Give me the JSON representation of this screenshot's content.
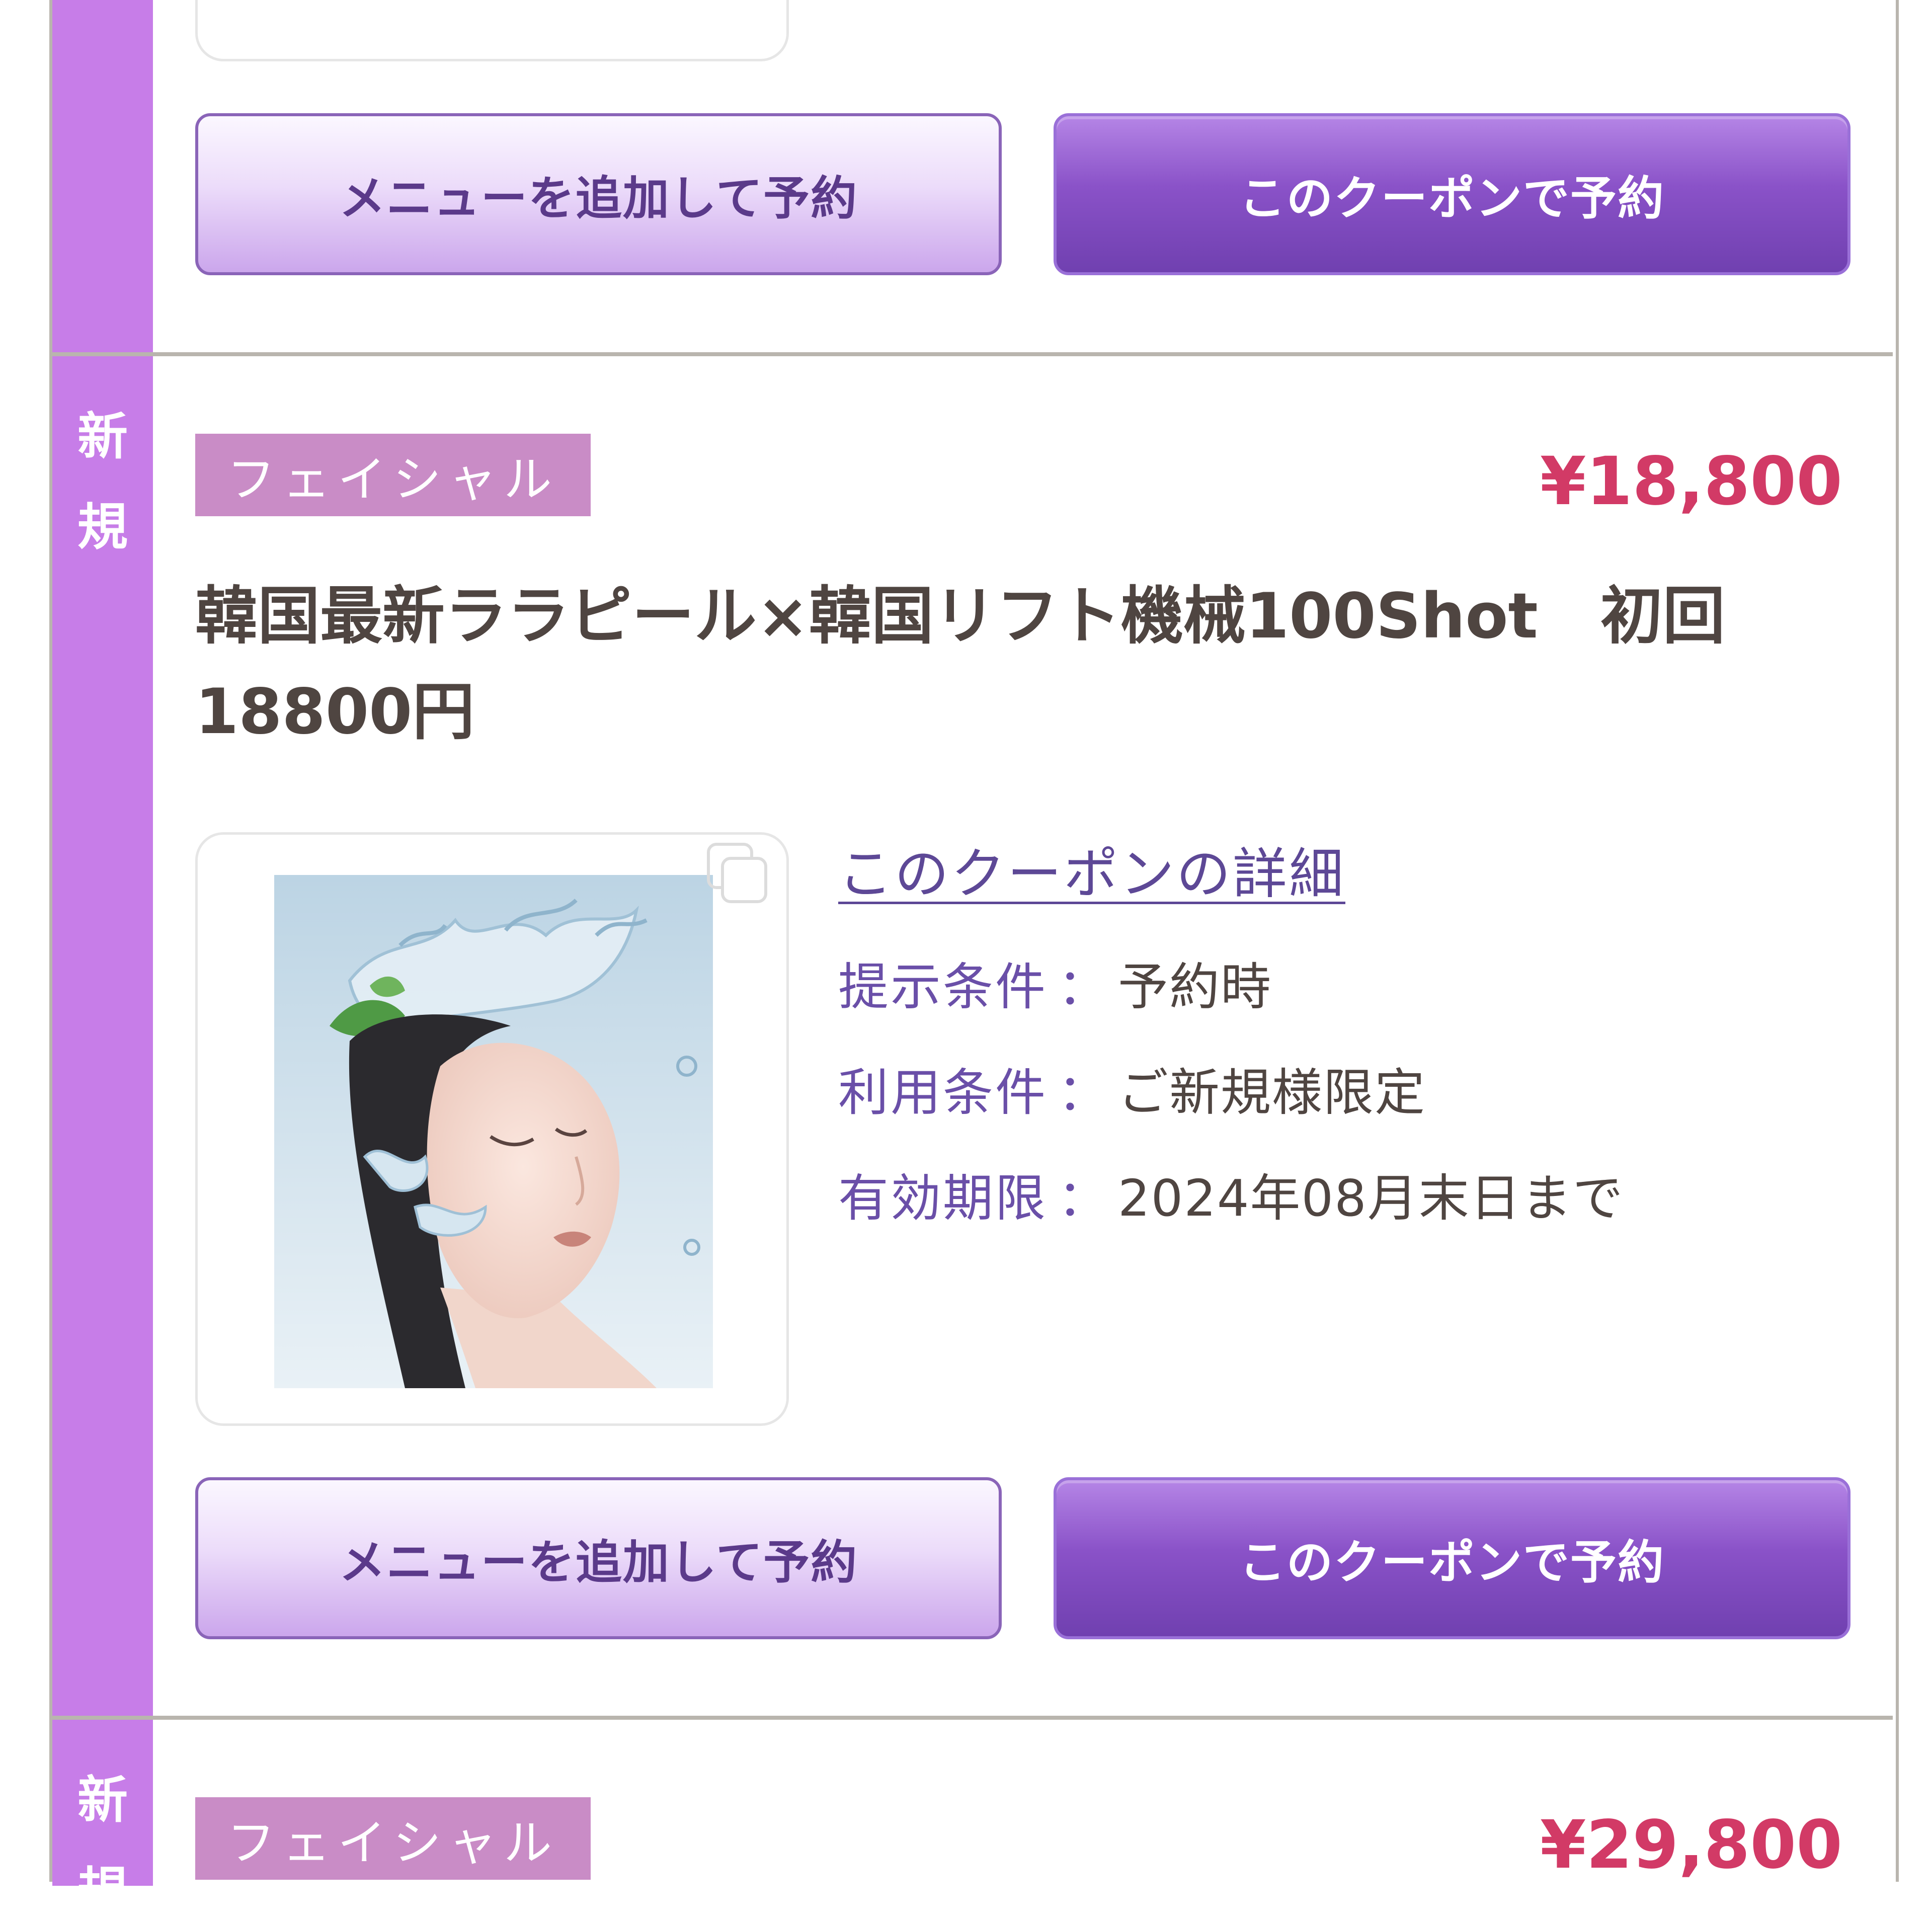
{
  "previous_coupon": {
    "add_menu_button": "メニューを追加して予約",
    "reserve_button": "このクーポンで予約"
  },
  "coupon": {
    "side_label": [
      "新",
      "規"
    ],
    "category_tag": "フェイシャル",
    "price": "¥18,800",
    "title": "韓国最新ララピール×韓国リフト機械100Shot　初回18800円",
    "detail_link": "このクーポンの詳細",
    "conditions": [
      {
        "label": "提示条件",
        "sep": "：",
        "value": "予約時"
      },
      {
        "label": "利用条件",
        "sep": "：",
        "value": "ご新規様限定"
      },
      {
        "label": "有効期限",
        "sep": "：",
        "value": "2024年08月末日まで"
      }
    ],
    "add_menu_button": "メニューを追加して予約",
    "reserve_button": "このクーポンで予約"
  },
  "next_coupon": {
    "side_label": [
      "新",
      "規"
    ],
    "category_tag": "フェイシャル",
    "price": "¥29,800"
  },
  "colors": {
    "side_bar": "#c77de8",
    "tag": "#c98cc6",
    "price": "#d23a66",
    "primary_button": "#8a52c8",
    "condition_label": "#6a4fa8"
  }
}
